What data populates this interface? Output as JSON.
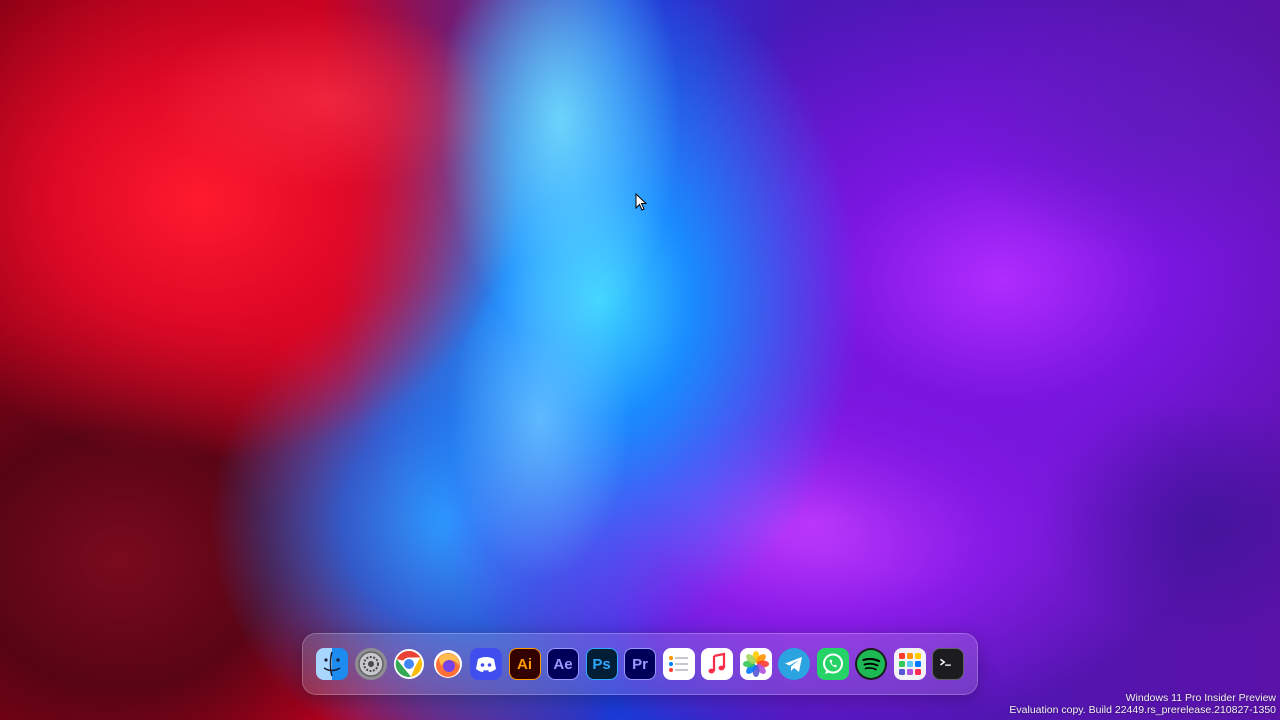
{
  "dock": {
    "apps": [
      {
        "name": "finder",
        "label": "",
        "bg": "#1e8bf0",
        "fg": "#ffffff"
      },
      {
        "name": "system-settings",
        "label": "",
        "bg": "#8e8e93",
        "fg": "#ffffff"
      },
      {
        "name": "chrome",
        "label": "",
        "bg": "#ffffff",
        "fg": "#ffffff"
      },
      {
        "name": "firefox",
        "label": "",
        "bg": "#ffffff",
        "fg": "#ffffff"
      },
      {
        "name": "discord",
        "label": "",
        "bg": "#404eed",
        "fg": "#ffffff"
      },
      {
        "name": "illustrator",
        "label": "Ai",
        "bg": "#330000",
        "fg": "#ff9a00"
      },
      {
        "name": "after-effects",
        "label": "Ae",
        "bg": "#00005b",
        "fg": "#9999ff"
      },
      {
        "name": "photoshop",
        "label": "Ps",
        "bg": "#001e36",
        "fg": "#31a8ff"
      },
      {
        "name": "premiere",
        "label": "Pr",
        "bg": "#00005b",
        "fg": "#9999ff"
      },
      {
        "name": "reminders",
        "label": "",
        "bg": "#ffffff",
        "fg": "#ff9500"
      },
      {
        "name": "music",
        "label": "",
        "bg": "#ffffff",
        "fg": "#fa2d48"
      },
      {
        "name": "photos",
        "label": "",
        "bg": "#ffffff",
        "fg": "#ffffff"
      },
      {
        "name": "telegram",
        "label": "",
        "bg": "#2aa3e0",
        "fg": "#ffffff"
      },
      {
        "name": "whatsapp",
        "label": "",
        "bg": "#25d366",
        "fg": "#ffffff"
      },
      {
        "name": "spotify",
        "label": "",
        "bg": "#1db954",
        "fg": "#000000"
      },
      {
        "name": "launchpad",
        "label": "",
        "bg": "#f2f2f7",
        "fg": "#ffffff"
      },
      {
        "name": "terminal",
        "label": "",
        "bg": "#1c1c1e",
        "fg": "#ffffff"
      }
    ]
  },
  "watermark": {
    "line1": "Windows 11 Pro Insider Preview",
    "line2": "Evaluation copy. Build 22449.rs_prerelease.210827-1350"
  },
  "cursor": {
    "icon": "arrow-cursor-icon"
  }
}
